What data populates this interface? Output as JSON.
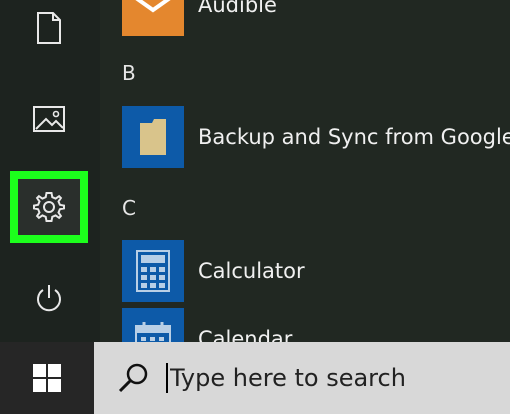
{
  "colors": {
    "rail_background": "#1d231f",
    "list_background": "#212822",
    "tile_blue": "#0d5aa8",
    "highlight_green": "#1cff1c",
    "taskbar": "#2b2b2b",
    "search_box": "#d8d8d8"
  },
  "rail": {
    "items": [
      {
        "icon": "document-icon",
        "selected": false
      },
      {
        "icon": "picture-icon",
        "selected": false
      },
      {
        "icon": "gear-icon",
        "selected": true
      },
      {
        "icon": "power-icon",
        "selected": false
      }
    ]
  },
  "applist": {
    "sections": [
      {
        "letter": "B"
      },
      {
        "letter": "C"
      }
    ],
    "apps": [
      {
        "label": "Audible",
        "icon": "audible-icon"
      },
      {
        "label": "Backup and Sync from Google",
        "icon": "google-drive-folder-icon"
      },
      {
        "label": "Calculator",
        "icon": "calculator-icon"
      },
      {
        "label": "Calendar",
        "icon": "calendar-icon"
      }
    ]
  },
  "taskbar": {
    "start_icon": "windows-logo-icon",
    "search": {
      "icon": "search-icon",
      "placeholder": "Type here to search"
    }
  }
}
